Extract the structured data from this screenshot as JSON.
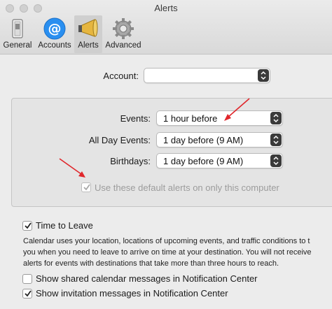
{
  "window": {
    "title": "Alerts"
  },
  "toolbar": {
    "items": [
      {
        "label": "General",
        "icon": "switch-icon"
      },
      {
        "label": "Accounts",
        "icon": "at-sign-icon"
      },
      {
        "label": "Alerts",
        "icon": "megaphone-icon",
        "selected": true
      },
      {
        "label": "Advanced",
        "icon": "gear-icon"
      }
    ]
  },
  "account": {
    "label": "Account:",
    "value": ""
  },
  "defaults": {
    "events_label": "Events:",
    "events_value": "1 hour before",
    "allday_label": "All Day Events:",
    "allday_value": "1 day before (9 AM)",
    "birthdays_label": "Birthdays:",
    "birthdays_value": "1 day before (9 AM)",
    "only_this_computer_label": "Use these default alerts on only this computer",
    "only_this_computer_checked": true
  },
  "time_to_leave": {
    "label": "Time to Leave",
    "checked": true,
    "description_lines": [
      "Calendar uses your location, locations of upcoming events, and traffic conditions to t",
      "you when you need to leave to arrive on time at your destination. You will not receive",
      "alerts for events with destinations that take more than three hours to reach."
    ]
  },
  "notifications": {
    "shared_label": "Show shared calendar messages in Notification Center",
    "shared_checked": false,
    "invitation_label": "Show invitation messages in Notification Center",
    "invitation_checked": true
  },
  "colors": {
    "annotation_arrow": "#e0262b",
    "accounts_icon": "#2a8ff0"
  }
}
